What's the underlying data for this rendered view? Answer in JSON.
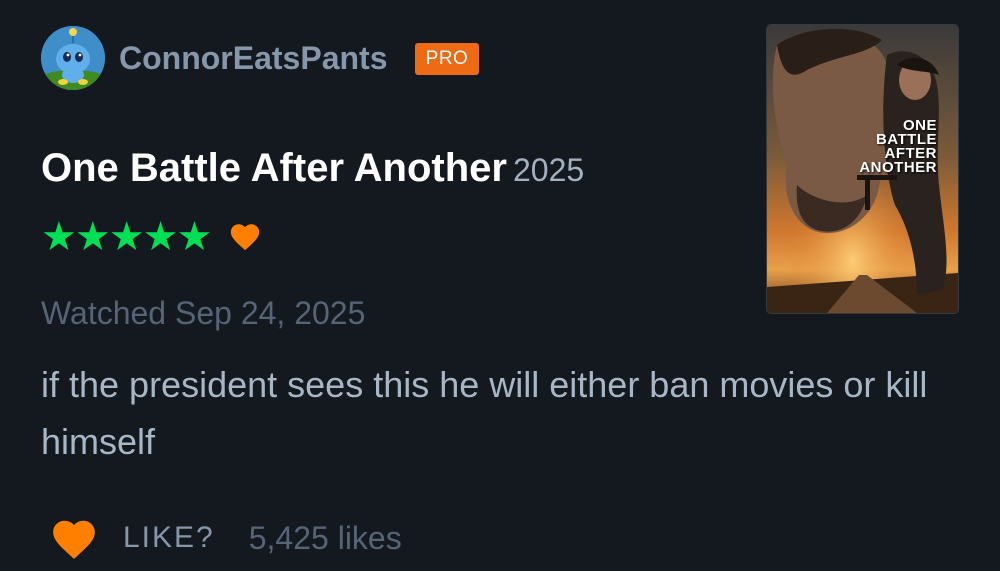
{
  "user": {
    "username": "ConnorEatsPants",
    "badge": "PRO",
    "avatar_icon": "chao-avatar"
  },
  "film": {
    "title": "One Battle After Another",
    "year": "2025",
    "poster_text": "ONE\nBATTLE\nAFTER\nANOTHER"
  },
  "rating": {
    "stars": 5,
    "stars_text": "★★★★★",
    "liked": true,
    "star_color": "#00e054",
    "heart_color": "#ff8000"
  },
  "watched": "Watched Sep 24, 2025",
  "review": {
    "text": "if the president sees this he will either ban movies or kill himself"
  },
  "actions": {
    "like_label": "LIKE?",
    "likes_count": "5,425 likes"
  },
  "colors": {
    "background": "#14181f",
    "accent_orange": "#ef6a14",
    "muted_text": "#8797ab",
    "dim_text": "#566476"
  }
}
